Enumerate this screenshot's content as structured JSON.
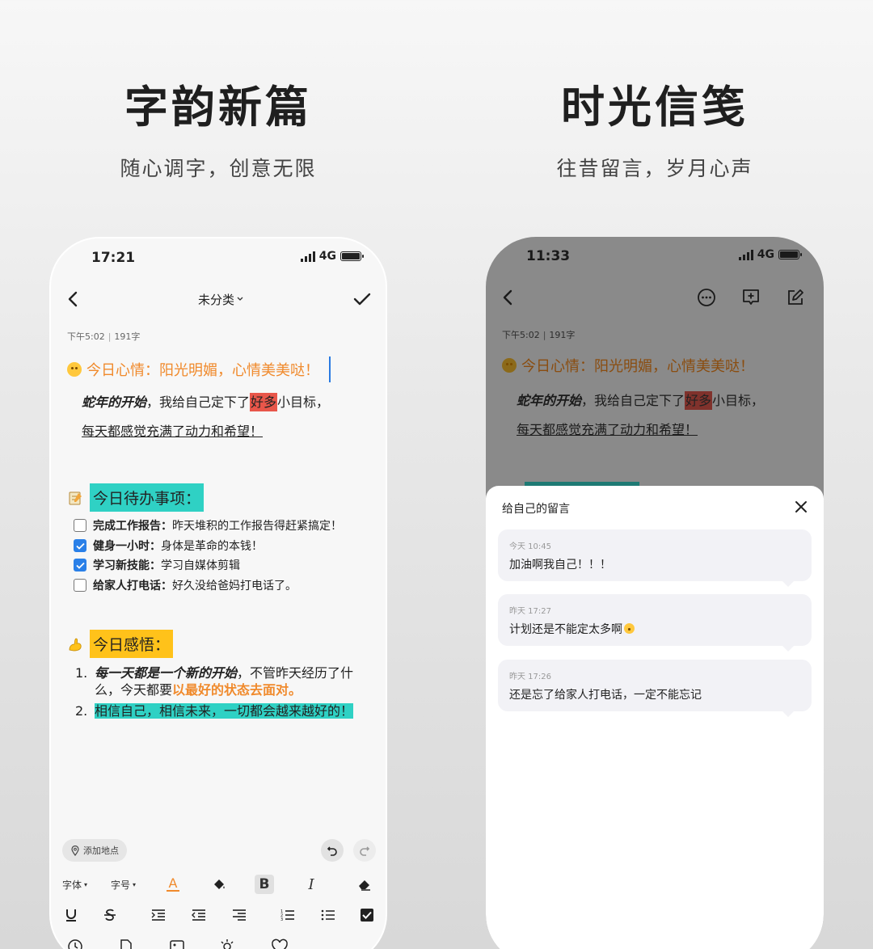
{
  "headlines": {
    "left": {
      "title": "字韵新篇",
      "subtitle": "随心调字，创意无限"
    },
    "right": {
      "title": "时光信笺",
      "subtitle": "往昔留言，岁月心声"
    }
  },
  "left_phone": {
    "status": {
      "time": "17:21",
      "network": "4G"
    },
    "nav": {
      "category": "未分类",
      "back_icon": "chevron-left-icon",
      "done_icon": "check-icon"
    },
    "meta": {
      "time": "下午5:02",
      "count": "191字"
    },
    "mood_line": "今日心情：阳光明媚，心情美美哒！",
    "line2_calligraphy": "蛇年的开始",
    "line2_a": "，我给自己定下了",
    "line2_highlight": "好多",
    "line2_b": "小目标，",
    "line3": "每天都感觉充满了动力和希望！",
    "todo_title": "今日待办事项：",
    "todos": [
      {
        "bold": "完成工作报告：",
        "text": "昨天堆积的工作报告得赶紧搞定！",
        "checked": false
      },
      {
        "bold": "健身一小时：",
        "text": "身体是革命的本钱！",
        "checked": true
      },
      {
        "bold": "学习新技能：",
        "text": "学习自媒体剪辑",
        "checked": true
      },
      {
        "bold": "给家人打电话：",
        "text": "好久没给爸妈打电话了。",
        "checked": false
      }
    ],
    "insight_title": "今日感悟：",
    "insights": [
      {
        "num": "1.",
        "italic": "每一天都是一个新的开始",
        "text_a": "，不管昨天经历了什么，今天都要",
        "orange": "以最好的状态去面对。"
      },
      {
        "num": "2.",
        "teal": "相信自己，相信未来，一切都会越来越好的！"
      }
    ],
    "location_label": "添加地点",
    "toolbar": {
      "font_label": "字体",
      "size_label": "字号",
      "bold_label": "B",
      "italic_label": "I"
    },
    "colors": {
      "orange": "#f08a2c",
      "teal": "#2fd1c4",
      "yellow": "#ffc21a",
      "red": "#e8564a",
      "blue": "#2a80e8"
    }
  },
  "right_phone": {
    "status": {
      "time": "11:33",
      "network": "4G"
    },
    "meta": {
      "time": "下午5:02",
      "count": "191字"
    },
    "mood_line": "今日心情：阳光明媚，心情美美哒！",
    "line2_calligraphy": "蛇年的开始",
    "line2_a": "，我给自己定下了",
    "line2_highlight": "好多",
    "line2_b": "小目标，",
    "line3": "每天都感觉充满了动力和希望！",
    "sheet": {
      "title": "给自己的留言",
      "messages": [
        {
          "time": "今天 10:45",
          "text": "加油啊我自己！！！"
        },
        {
          "time": "昨天 17:27",
          "text": "计划还是不能定太多啊"
        },
        {
          "time": "昨天 17:26",
          "text": "还是忘了给家人打电话，一定不能忘记"
        }
      ]
    }
  }
}
